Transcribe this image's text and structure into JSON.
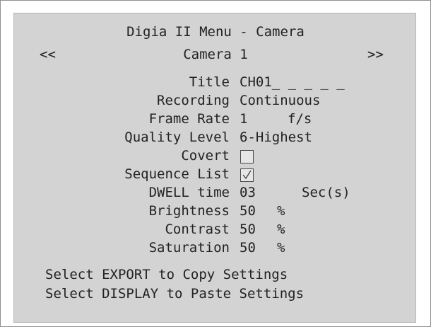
{
  "menu": {
    "title": "Digia II Menu - Camera",
    "prev_label": "<<",
    "next_label": ">>",
    "camera_label": "Camera 1"
  },
  "settings": {
    "title": {
      "label": "Title",
      "value": "CH01_ _ _ _ _"
    },
    "recording": {
      "label": "Recording",
      "value": "Continuous"
    },
    "frame_rate": {
      "label": "Frame Rate",
      "value": "1",
      "unit": "f/s"
    },
    "quality": {
      "label": "Quality Level",
      "value": "6-Highest"
    },
    "covert": {
      "label": "Covert",
      "checked": false
    },
    "sequence": {
      "label": "Sequence List",
      "checked": true
    },
    "dwell": {
      "label": "DWELL time",
      "value": "03",
      "unit": "Sec(s)"
    },
    "brightness": {
      "label": "Brightness",
      "value": "50",
      "unit": "%"
    },
    "contrast": {
      "label": "Contrast",
      "value": "50",
      "unit": "%"
    },
    "saturation": {
      "label": "Saturation",
      "value": "50",
      "unit": "%"
    }
  },
  "footer": {
    "export_hint": "Select EXPORT to Copy Settings",
    "display_hint": "Select DISPLAY to Paste Settings"
  },
  "colors": {
    "panel_bg": "#d3d3d3",
    "text": "#222222"
  }
}
